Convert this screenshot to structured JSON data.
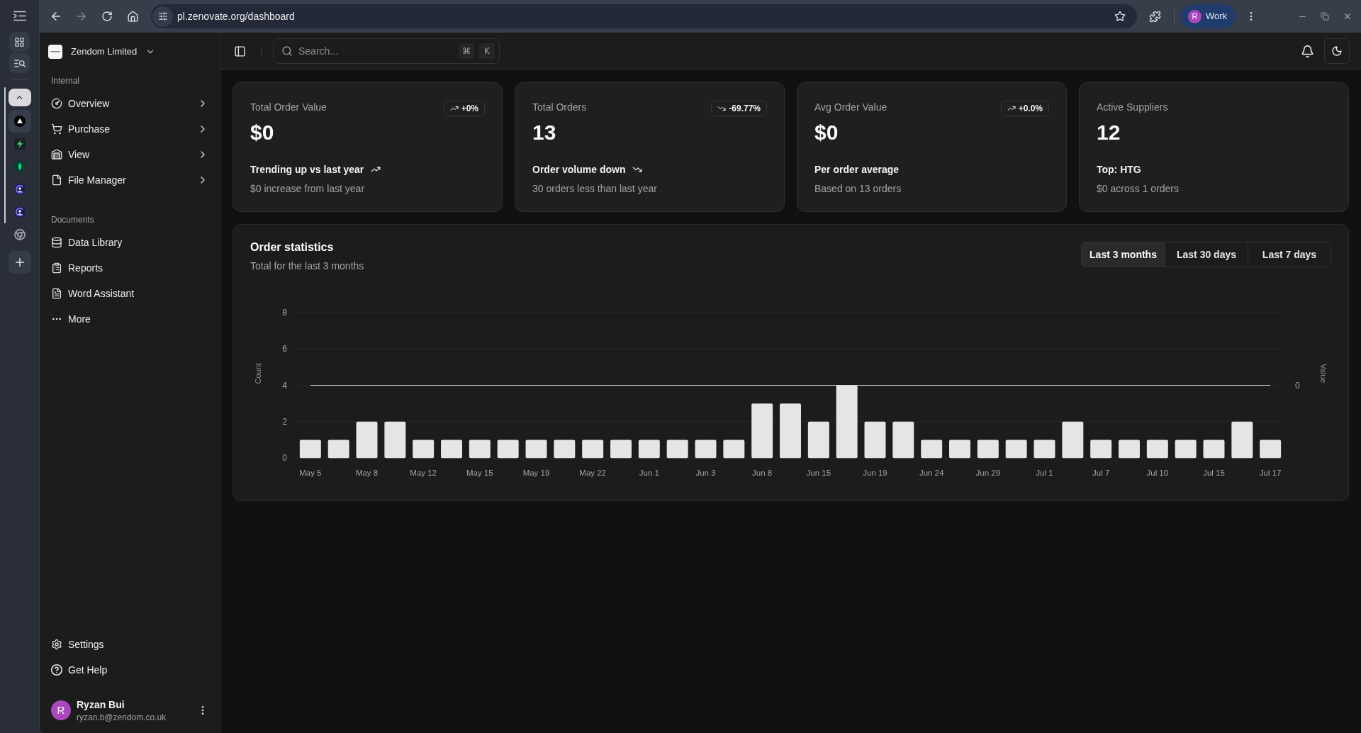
{
  "browser": {
    "address": "pl.zenovate.org/dashboard",
    "profile": {
      "initial": "R",
      "label": "Work"
    },
    "tab_group": [
      {
        "kind": "triangle",
        "selected": true
      },
      {
        "kind": "bolt",
        "selected": false
      },
      {
        "kind": "leaf",
        "selected": false
      },
      {
        "kind": "ring",
        "selected": false
      },
      {
        "kind": "ring",
        "selected": false
      }
    ],
    "tabs": [
      {
        "kind": "aperture",
        "selected": false
      }
    ]
  },
  "sidebar": {
    "workspace": "Zendom Limited",
    "sections": [
      {
        "title": "Internal",
        "items": [
          {
            "label": "Overview",
            "expandable": true
          },
          {
            "label": "Purchase",
            "expandable": true
          },
          {
            "label": "View",
            "expandable": true
          },
          {
            "label": "File Manager",
            "expandable": true
          }
        ]
      },
      {
        "title": "Documents",
        "items": [
          {
            "label": "Data Library",
            "expandable": false
          },
          {
            "label": "Reports",
            "expandable": false
          },
          {
            "label": "Word Assistant",
            "expandable": false
          },
          {
            "label": "More",
            "expandable": false
          }
        ]
      }
    ],
    "footer_items": [
      {
        "label": "Settings"
      },
      {
        "label": "Get Help"
      }
    ],
    "user": {
      "initial": "R",
      "name": "Ryzan Bui",
      "email": "ryzan.b@zendom.co.uk"
    }
  },
  "header": {
    "search": {
      "placeholder": "Search...",
      "shortcut": [
        "⌘",
        "K"
      ]
    }
  },
  "stats": [
    {
      "label": "Total Order Value",
      "value": "$0",
      "change": "+0%",
      "rising": true,
      "headline": "Trending up vs last year",
      "headline_arrow": true,
      "detail": "$0 increase from last year"
    },
    {
      "label": "Total Orders",
      "value": "13",
      "change": "-69.77%",
      "rising": false,
      "headline": "Order volume down",
      "headline_arrow": true,
      "detail": "30 orders less than last year"
    },
    {
      "label": "Avg Order Value",
      "value": "$0",
      "change": "+0.0%",
      "rising": true,
      "headline": "Per order average",
      "headline_arrow": false,
      "detail": "Based on 13 orders"
    },
    {
      "label": "Active Suppliers",
      "value": "12",
      "headline": "Top: HTG",
      "headline_arrow": false,
      "detail": "$0 across 1 orders"
    }
  ],
  "order_statistics": {
    "title": "Order statistics",
    "subtitle": "Total for the last 3 months",
    "ranges": [
      {
        "label": "Last 3 months",
        "selected": true
      },
      {
        "label": "Last 30 days",
        "selected": false
      },
      {
        "label": "Last 7 days",
        "selected": false
      }
    ],
    "chart_data": {
      "type": "bar",
      "categories": [
        "May 5",
        null,
        "May 8",
        null,
        "May 12",
        null,
        "May 15",
        null,
        "May 19",
        null,
        "May 22",
        null,
        "Jun 1",
        null,
        "Jun 3",
        null,
        "Jun 8",
        null,
        "Jun 15",
        null,
        "Jun 19",
        null,
        "Jun 24",
        null,
        "Jun 29",
        null,
        "Jul 1",
        null,
        "Jul 7",
        null,
        "Jul 10",
        null,
        "Jul 15",
        null,
        "Jul 17"
      ],
      "ylim": [
        0,
        8
      ],
      "yticks": [
        0,
        2,
        4,
        6,
        8
      ],
      "grid": true,
      "y2label": "Value",
      "series": [
        {
          "name": "Count",
          "color": "#e5e5e5",
          "values": [
            1,
            1,
            2,
            2,
            1,
            1,
            1,
            1,
            1,
            1,
            1,
            1,
            1,
            1,
            1,
            1,
            3,
            3,
            2,
            4,
            2,
            2,
            1,
            1,
            1,
            1,
            1,
            2,
            1,
            1,
            1,
            1,
            1,
            2,
            1
          ]
        }
      ],
      "annotations": [
        "0"
      ]
    }
  }
}
